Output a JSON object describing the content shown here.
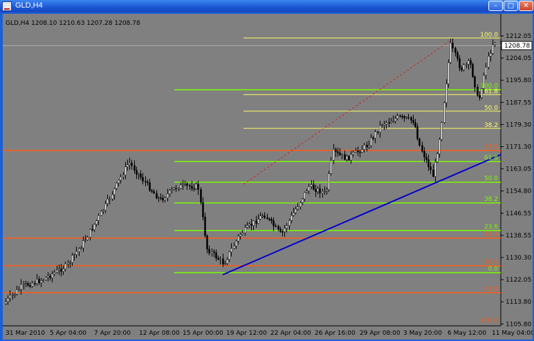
{
  "window": {
    "title": "GLD,H4",
    "buttons": {
      "minimize": "–",
      "maximize": "□",
      "close": "✕"
    }
  },
  "chart": {
    "ohlc_label": "GLD,H4  1208.10 1210.63 1207.28 1208.78",
    "current_price": "1208.78",
    "price_ticks": [
      "1212.05",
      "1204.05",
      "1195.80",
      "1187.55",
      "1179.30",
      "1171.30",
      "1163.05",
      "1154.80",
      "1146.55",
      "1138.55",
      "1130.30",
      "1122.05",
      "1113.80",
      "1105.80"
    ],
    "time_ticks": [
      "31 Mar 2010",
      "5 Apr 04:00",
      "7 Apr 20:00",
      "12 Apr 08:00",
      "15 Apr 00:00",
      "19 Apr 12:00",
      "22 Apr 04:00",
      "26 Apr 16:00",
      "29 Apr 08:00",
      "3 May 20:00",
      "6 May 12:00",
      "11 May 04:00"
    ],
    "yellow_fib_labels": [
      "100.0",
      "61.8",
      "50.0",
      "38.2"
    ],
    "green_fib_labels": [
      "100.0",
      "61.8",
      "50.0",
      "38.2",
      "23.6",
      "0.0"
    ],
    "orange_fib_labels": [
      "23.6",
      "38.2",
      "50.0",
      "61.8",
      "100.0"
    ],
    "colors": {
      "background": "#808080",
      "bull": "#ffffff",
      "bear": "#000000",
      "yellow": "#ffff66",
      "green": "#7cfc00",
      "orange": "#ff5a14",
      "trend": "#0000cc",
      "diagonal": "#cc2222"
    }
  }
}
